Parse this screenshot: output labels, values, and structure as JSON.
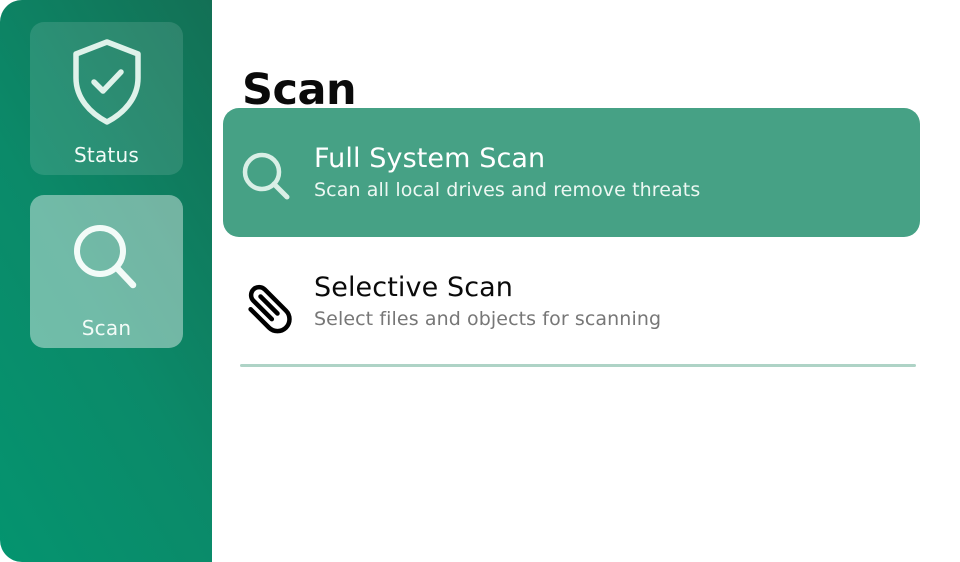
{
  "sidebar": {
    "items": [
      {
        "label": "Status",
        "icon": "shield-check-icon",
        "active": false
      },
      {
        "label": "Scan",
        "icon": "search-icon",
        "active": true
      }
    ]
  },
  "main": {
    "title": "Scan",
    "options": [
      {
        "title": "Full System Scan",
        "description": "Scan all local drives and remove threats",
        "icon": "search-icon",
        "selected": true
      },
      {
        "title": "Selective Scan",
        "description": "Select files and objects for scanning",
        "icon": "paperclip-icon",
        "selected": false
      }
    ]
  },
  "colors": {
    "sidebar_gradient_start": "#04946f",
    "sidebar_gradient_end": "#137055",
    "selected_option": "#46a185",
    "divider": "#aed3c6"
  }
}
